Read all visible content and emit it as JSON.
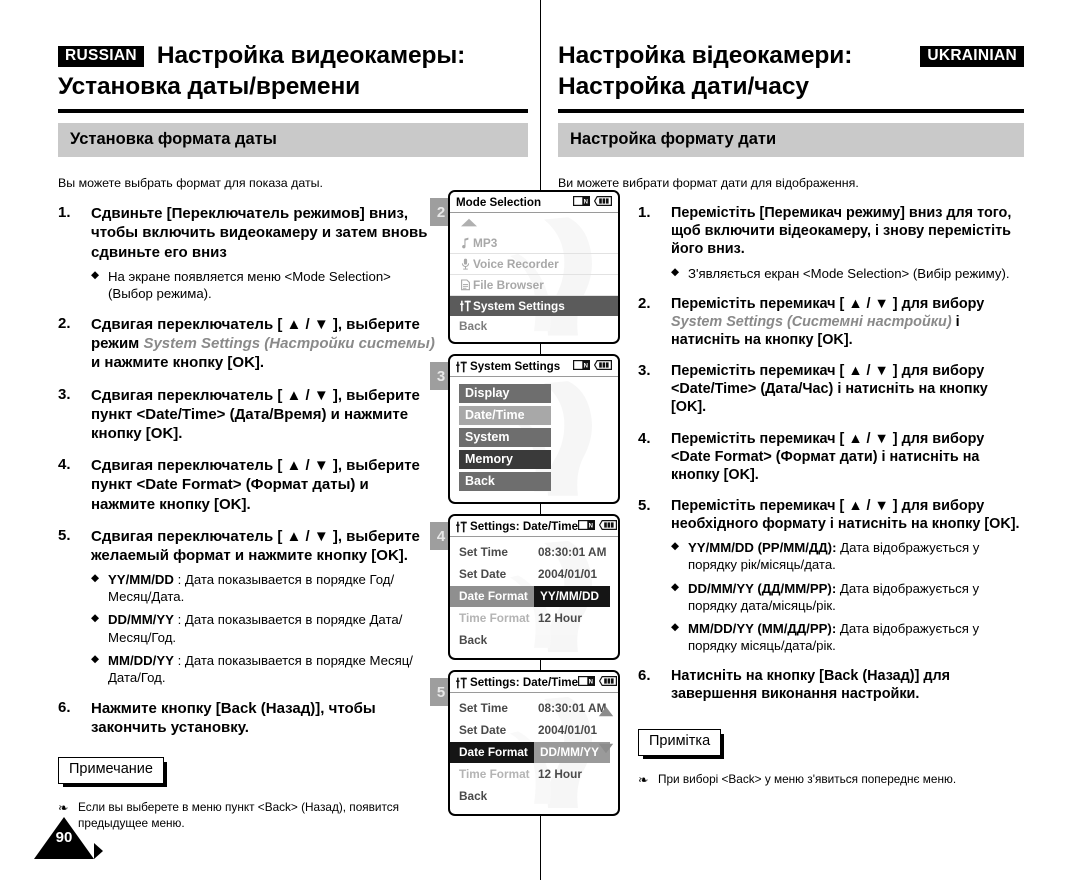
{
  "page": {
    "number": "90"
  },
  "russian": {
    "lang_tag": "RUSSIAN",
    "title_line1": "Настройка видеокамеры:",
    "title_line2": "Установка даты/времени",
    "band": "Установка формата даты",
    "intro": "Вы можете выбрать формат для показа даты.",
    "steps": [
      {
        "num": "1.",
        "text": "Сдвиньте [Переключатель режимов] вниз, чтобы включить видеокамеру и затем вновь сдвиньте его вниз",
        "subs": [
          {
            "text": "На экране появляется меню <Mode Selection> (Выбор режима)."
          }
        ]
      },
      {
        "num": "2.",
        "pre": "Сдвигая переключатель [ ▲ / ▼ ], выберите режим ",
        "italic": "System Settings (Настройки системы)",
        "post": " и нажмите кнопку [OK].",
        "subs": []
      },
      {
        "num": "3.",
        "text": "Сдвигая переключатель [ ▲ / ▼ ], выберите пункт <Date/Time> (Дата/Время) и нажмите кнопку [OK].",
        "subs": []
      },
      {
        "num": "4.",
        "text": "Сдвигая переключатель [ ▲ / ▼ ], выберите пункт <Date Format> (Формат даты) и нажмите кнопку [OK].",
        "subs": []
      },
      {
        "num": "5.",
        "text": "Сдвигая переключатель [ ▲ / ▼ ], выберите желаемый формат и нажмите кнопку [OK].",
        "subs": [
          {
            "bold": "YY/MM/DD",
            "text": " : Дата показывается в порядке Год/Месяц/Дата."
          },
          {
            "bold": "DD/MM/YY",
            "text": " : Дата показывается в порядке Дата/Месяц/Год."
          },
          {
            "bold": "MM/DD/YY",
            "text": " : Дата показывается в порядке Месяц/Дата/Год."
          }
        ]
      },
      {
        "num": "6.",
        "text": "Нажмите кнопку [Back (Назад)], чтобы закончить установку.",
        "subs": []
      }
    ],
    "note_label": "Примечание",
    "note_text": "Если вы выберете в меню пункт <Back> (Назад), появится предыдущее меню."
  },
  "ukrainian": {
    "lang_tag": "UKRAINIAN",
    "title_line1": "Настройка відеокамери:",
    "title_line2": "Настройка дати/часу",
    "band": "Настройка формату дати",
    "intro": "Ви можете вибрати формат дати для відображення.",
    "steps": [
      {
        "num": "1.",
        "text": "Перемістіть [Перемикач режиму] вниз для того, щоб включити відеокамеру, і знову перемістіть його вниз.",
        "subs": [
          {
            "text": "З'являється екран <Mode Selection> (Вибір режиму)."
          }
        ]
      },
      {
        "num": "2.",
        "pre": "Перемістіть перемикач [ ▲ / ▼ ] для вибору ",
        "italic": "System Settings (Системні настройки)",
        "post": " і натисніть на кнопку [OK].",
        "subs": []
      },
      {
        "num": "3.",
        "text": "Перемістіть перемикач [ ▲ / ▼ ] для вибору <Date/Time> (Дата/Час) і натисніть на кнопку [OK].",
        "subs": []
      },
      {
        "num": "4.",
        "text": "Перемістіть перемикач [ ▲ / ▼ ] для вибору <Date Format> (Формат дати) і натисніть на кнопку [OK].",
        "subs": []
      },
      {
        "num": "5.",
        "text": "Перемістіть перемикач [ ▲ / ▼ ] для вибору необхідного формату і натисніть на кнопку [OK].",
        "subs": [
          {
            "bold": "YY/MM/DD (РР/ММ/ДД):",
            "text": " Дата відображується у порядку рік/місяць/дата."
          },
          {
            "bold": "DD/MM/YY (ДД/ММ/РР):",
            "text": " Дата відображується у порядку дата/місяць/рік."
          },
          {
            "bold": "MM/DD/YY (ММ/ДД/РР):",
            "text": " Дата відображується у порядку місяць/дата/рік."
          }
        ]
      },
      {
        "num": "6.",
        "text": "Натисніть на кнопку [Back (Назад)] для завершення виконання настройки.",
        "subs": []
      }
    ],
    "note_label": "Примітка",
    "note_text": "При виборі <Back> у меню з'явиться попереднє меню."
  },
  "screens": [
    {
      "badge": "2",
      "title": "Mode Selection",
      "title_icon": "",
      "type": "list",
      "rows": [
        {
          "icon": "music-note-icon",
          "label": "MP3",
          "state": "dim"
        },
        {
          "icon": "microphone-icon",
          "label": "Voice Recorder",
          "state": "dim"
        },
        {
          "icon": "file-icon",
          "label": "File Browser",
          "state": "dim"
        },
        {
          "icon": "sliders-icon",
          "label": "System Settings",
          "state": "selected"
        },
        {
          "icon": "",
          "label": "Back",
          "state": "plain"
        }
      ]
    },
    {
      "badge": "3",
      "title": "System Settings",
      "title_icon": "sliders-icon",
      "type": "buttons",
      "buttons": [
        {
          "label": "Display",
          "shade": "btn-g1"
        },
        {
          "label": "Date/Time",
          "shade": "btn-g2"
        },
        {
          "label": "System",
          "shade": "btn-g3"
        },
        {
          "label": "Memory",
          "shade": "btn-g4"
        },
        {
          "label": "Back",
          "shade": "btn-g5"
        }
      ]
    },
    {
      "badge": "4",
      "title": "Settings: Date/Time",
      "title_icon": "sliders-icon",
      "type": "table",
      "arrows": false,
      "rows": [
        {
          "label": "Set Time",
          "value": "08:30:01 AM",
          "label_style": "g-dark",
          "value_style": "g-dark"
        },
        {
          "label": "Set Date",
          "value": "2004/01/01",
          "label_style": "g-dark",
          "value_style": "g-dark"
        },
        {
          "label": "Date Format",
          "value": "YY/MM/DD",
          "label_style": "sel-grey",
          "value_style": "box-black"
        },
        {
          "label": "Time Format",
          "value": "12 Hour",
          "label_style": "g-light",
          "value_style": "g-dark"
        },
        {
          "label": "Back",
          "value": "",
          "label_style": "g-dark",
          "value_style": "g-dark"
        }
      ]
    },
    {
      "badge": "5",
      "title": "Settings: Date/Time",
      "title_icon": "sliders-icon",
      "type": "table",
      "arrows": true,
      "rows": [
        {
          "label": "Set Time",
          "value": "08:30:01 AM",
          "label_style": "g-dark",
          "value_style": "g-dark"
        },
        {
          "label": "Set Date",
          "value": "2004/01/01",
          "label_style": "g-dark",
          "value_style": "g-dark"
        },
        {
          "label": "Date Format",
          "value": "DD/MM/YY",
          "label_style": "sel-black",
          "value_style": "box-grey"
        },
        {
          "label": "Time Format",
          "value": "12 Hour",
          "label_style": "g-light",
          "value_style": "g-dark"
        },
        {
          "label": "Back",
          "value": "",
          "label_style": "g-dark",
          "value_style": "g-dark"
        }
      ]
    }
  ],
  "icons": {
    "card": "memory-card-icon",
    "battery": "battery-full-icon"
  }
}
